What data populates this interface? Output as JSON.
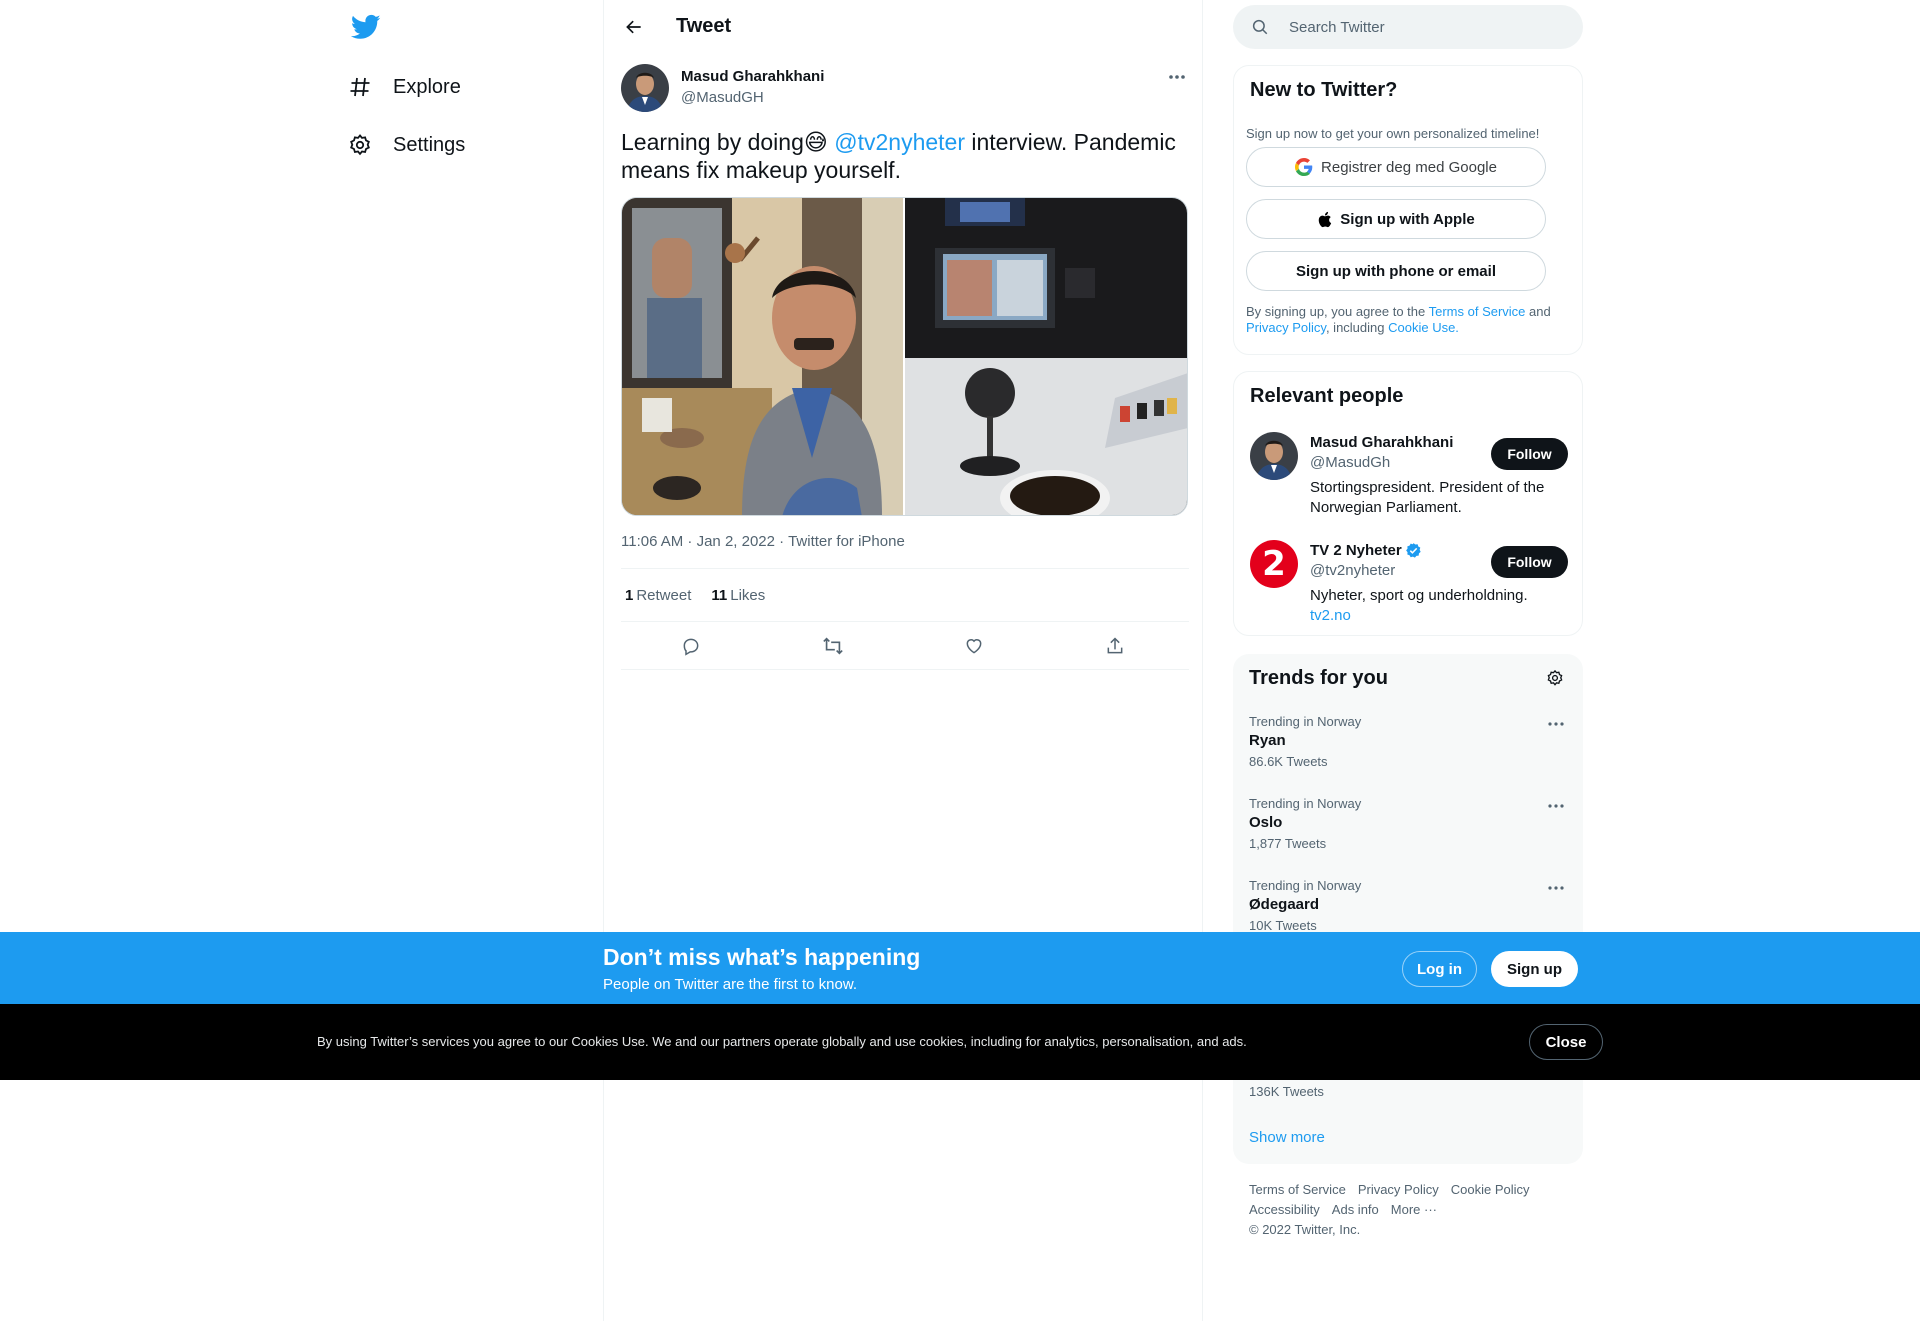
{
  "colors": {
    "brand": "#1d9bf0",
    "text": "#0f1419",
    "secondary_text": "#536471",
    "banner_bg": "#1d9bf0",
    "cookie_bg": "#000000",
    "verified": "#1d9bf0"
  },
  "nav": {
    "logo_icon": "twitter-bird-icon",
    "items": [
      {
        "label": "Explore",
        "icon": "hashtag-icon"
      },
      {
        "label": "Settings",
        "icon": "gear-icon"
      }
    ]
  },
  "header": {
    "title": "Tweet",
    "back_icon": "arrow-left-icon"
  },
  "tweet": {
    "author_name": "Masud Gharahkhani",
    "author_handle": "@MasudGH",
    "text_before": "Learning by doing",
    "emoji": "😅",
    "mention": "@tv2nyheter",
    "text_after": " interview. Pandemic means fix makeup yourself.",
    "timestamp": "11:06 AM · Jan 2, 2022",
    "separator": " · ",
    "source": "Twitter for iPhone",
    "retweets_count": "1",
    "retweets_label": "Retweet",
    "likes_count": "11",
    "likes_label": "Likes"
  },
  "search": {
    "placeholder": "Search Twitter"
  },
  "signup_box": {
    "title": "New to Twitter?",
    "subtitle": "Sign up now to get your own personalized timeline!",
    "google_label": "Registrer deg med Google",
    "apple_label": "Sign up with Apple",
    "phone_label": "Sign up with phone or email",
    "legal_prefix": "By signing up, you agree to the ",
    "terms_link": "Terms of Service",
    "legal_and": " and ",
    "privacy_link": "Privacy Policy",
    "legal_including": ", including ",
    "cookie_link": "Cookie Use."
  },
  "relevant": {
    "title": "Relevant people",
    "people": [
      {
        "name": "Masud Gharahkhani",
        "handle": "@MasudGh",
        "bio": "Stortingspresident. President of the Norwegian Parliament.",
        "follow_label": "Follow"
      },
      {
        "name": "TV 2 Nyheter",
        "handle": "@tv2nyheter",
        "bio": "Nyheter, sport og underholdning.",
        "link": "tv2.no",
        "follow_label": "Follow",
        "logo_text": "2"
      }
    ]
  },
  "trends": {
    "title": "Trends for you",
    "items": [
      {
        "context": "Trending in Norway",
        "name": "Ryan",
        "count": "86.6K Tweets"
      },
      {
        "context": "Trending in Norway",
        "name": "Oslo",
        "count": "1,877 Tweets"
      },
      {
        "context": "Trending in Norway",
        "name": "Ødegaard",
        "count": "10K Tweets"
      }
    ],
    "hidden_count": "136K Tweets",
    "show_more": "Show more"
  },
  "footer": {
    "links": [
      "Terms of Service",
      "Privacy Policy",
      "Cookie Policy",
      "Accessibility",
      "Ads info",
      "More ···"
    ],
    "copyright": "© 2022 Twitter, Inc."
  },
  "banner": {
    "title": "Don’t miss what’s happening",
    "subtitle": "People on Twitter are the first to know.",
    "login_label": "Log in",
    "signup_label": "Sign up"
  },
  "cookie": {
    "text": "By using Twitter’s services you agree to our Cookies Use. We and our partners operate globally and use cookies, including for analytics, personalisation, and ads.",
    "close_label": "Close"
  }
}
